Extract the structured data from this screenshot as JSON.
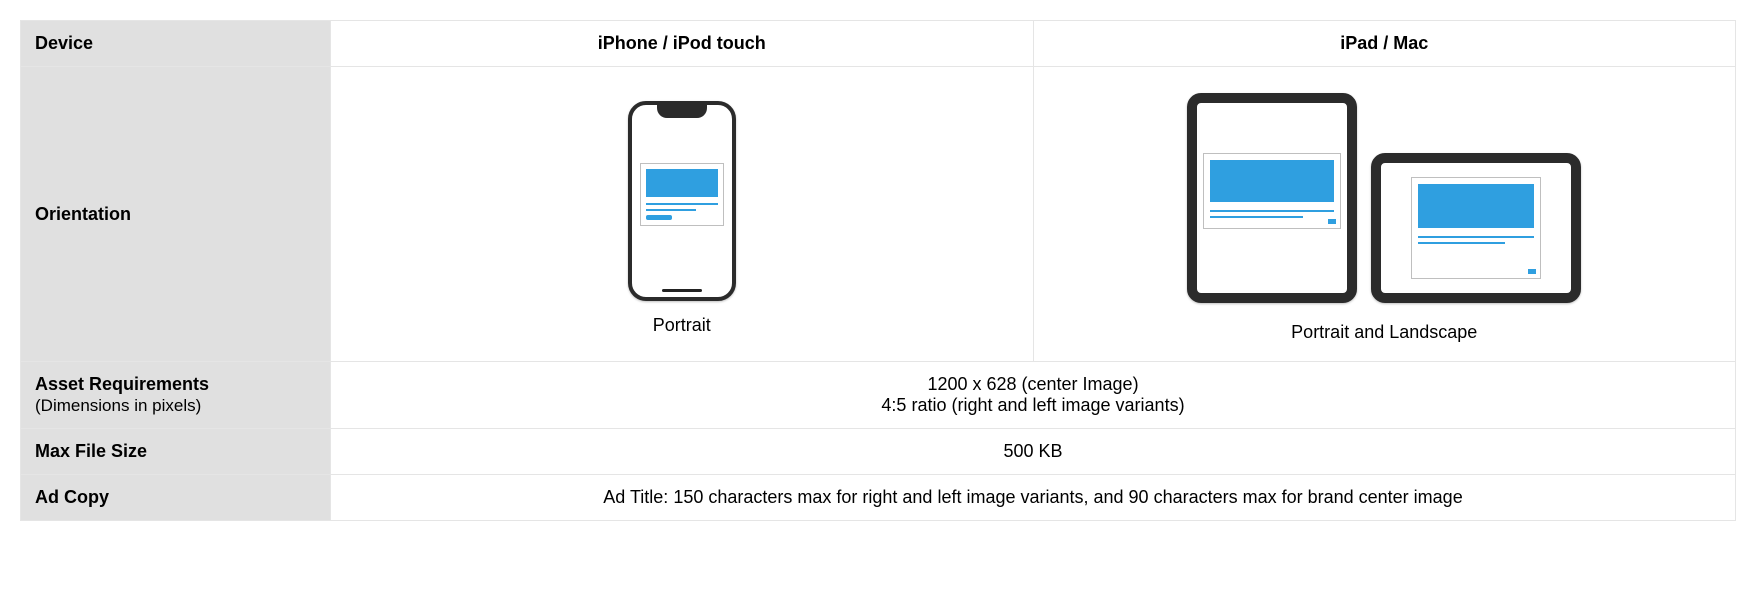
{
  "headers": {
    "device": "Device",
    "col1": "iPhone / iPod touch",
    "col2": "iPad / Mac"
  },
  "rows": {
    "orientation": {
      "label": "Orientation",
      "iphone_caption": "Portrait",
      "ipad_caption": "Portrait and Landscape"
    },
    "asset": {
      "label": "Asset Requirements",
      "sublabel": "(Dimensions in pixels)",
      "line1": "1200 x 628 (center Image)",
      "line2": "4:5 ratio (right and left image variants)"
    },
    "filesize": {
      "label": "Max File Size",
      "value": "500 KB"
    },
    "adcopy": {
      "label": "Ad Copy",
      "value": "Ad Title:  150 characters max for right and left image variants, and 90 characters max for brand center image"
    }
  }
}
